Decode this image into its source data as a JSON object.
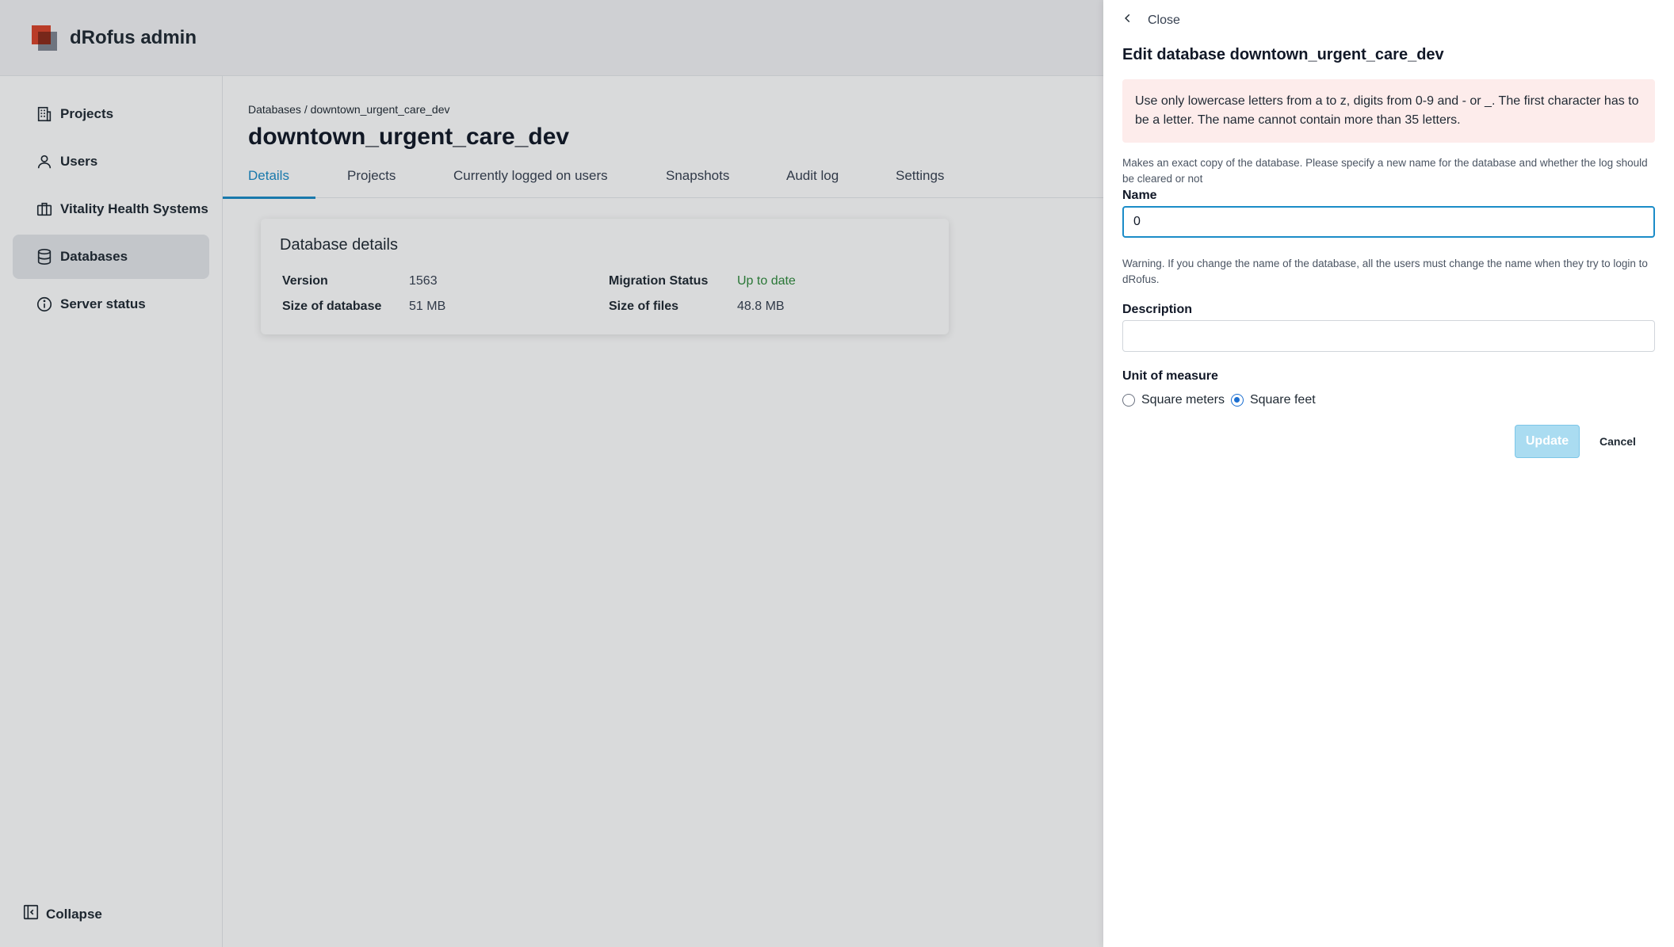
{
  "app": {
    "brand": "dRofus admin"
  },
  "sidebar": {
    "items": [
      {
        "label": "Projects",
        "icon": "building-icon"
      },
      {
        "label": "Users",
        "icon": "user-icon"
      },
      {
        "label": "Vitality Health Systems",
        "icon": "briefcase-icon"
      },
      {
        "label": "Databases",
        "icon": "database-icon",
        "active": true
      },
      {
        "label": "Server status",
        "icon": "info-icon"
      }
    ],
    "collapse_label": "Collapse"
  },
  "main": {
    "breadcrumb": "Databases / downtown_urgent_care_dev",
    "title": "downtown_urgent_care_dev",
    "tabs": [
      "Details",
      "Projects",
      "Currently logged on users",
      "Snapshots",
      "Audit log",
      "Settings"
    ],
    "active_tab": "Details",
    "card": {
      "title": "Database details",
      "version_label": "Version",
      "version_value": "1563",
      "size_db_label": "Size of database",
      "size_db_value": "51 MB",
      "migration_label": "Migration Status",
      "migration_value": "Up to date",
      "size_files_label": "Size of files",
      "size_files_value": "48.8 MB"
    }
  },
  "drawer": {
    "close_label": "Close",
    "title": "Edit database downtown_urgent_care_dev",
    "alert": "Use only lowercase letters from a to z, digits from 0-9 and - or _. The first character has to be a letter. The name cannot contain more than 35 letters.",
    "copy_help": "Makes an exact copy of the database. Please specify a new name for the database and whether the log should be cleared or not",
    "name_label": "Name",
    "name_value": "0",
    "warning": "Warning. If you change the name of the database, all the users must change the name when they try to login to dRofus.",
    "description_label": "Description",
    "description_value": "",
    "unit_label": "Unit of measure",
    "unit_options": [
      "Square meters",
      "Square feet"
    ],
    "unit_selected": "Square feet",
    "update_label": "Update",
    "cancel_label": "Cancel"
  },
  "colors": {
    "accent": "#1b8cc8",
    "success": "#2f8a3c",
    "alert_bg": "#fdeceb",
    "brand_red": "#d9432a"
  }
}
